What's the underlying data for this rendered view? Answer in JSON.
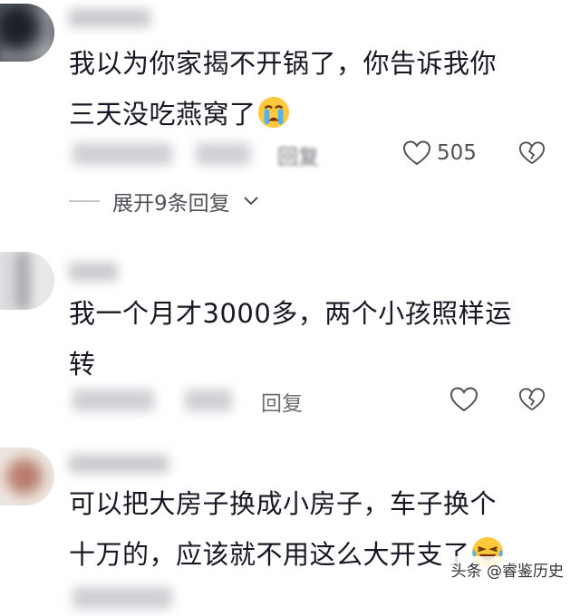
{
  "comments": [
    {
      "name": "……… ………",
      "text_lines": [
        "我以为你家揭不开锅了，你告诉我你",
        "三天没吃燕窝了"
      ],
      "emoji": "crying-face",
      "reply_label": "回复",
      "likes": "505",
      "expand_label": "展开9条回复"
    },
    {
      "name": "……",
      "text_lines": [
        "我一个月才3000多，两个小孩照样运",
        "转"
      ],
      "reply_label": "回复"
    },
    {
      "name": "…… ……",
      "text_lines": [
        "可以把大房子换成小房子，车子换个",
        "十万的，应该就不用这么大开支了"
      ],
      "emoji": "laughing-face"
    }
  ],
  "watermark": "头条 @睿鉴历史",
  "colors": {
    "accent_text": "#161823",
    "meta_text": "#6e6e76",
    "icon_stroke": "#505058"
  }
}
